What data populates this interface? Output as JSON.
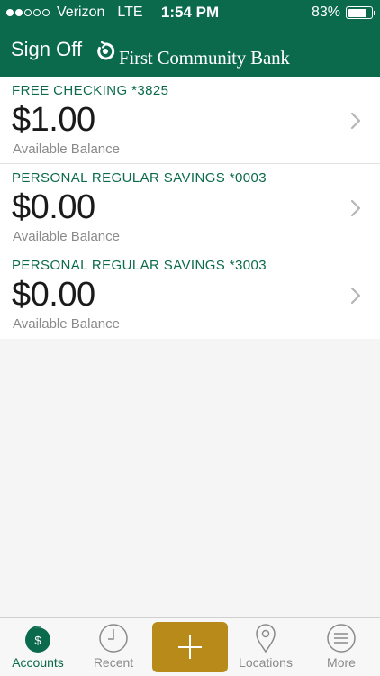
{
  "status_bar": {
    "carrier": "Verizon",
    "network": "LTE",
    "time": "1:54 PM",
    "battery": "83%",
    "battery_level": 0.83,
    "signal_bars_filled": 2,
    "signal_bars_total": 5
  },
  "header": {
    "sign_off_label": "Sign Off",
    "brand_name": "First Community Bank",
    "brand_logo_icon": "bank-logo-icon"
  },
  "accounts": [
    {
      "name": "FREE CHECKING *3825",
      "balance": "$1.00",
      "balance_label": "Available Balance"
    },
    {
      "name": "PERSONAL REGULAR SAVINGS *0003",
      "balance": "$0.00",
      "balance_label": "Available Balance"
    },
    {
      "name": "PERSONAL REGULAR SAVINGS *3003",
      "balance": "$0.00",
      "balance_label": "Available Balance"
    }
  ],
  "tab_bar": {
    "tabs": [
      {
        "label": "Accounts",
        "icon": "dollar-circle-icon",
        "active": true
      },
      {
        "label": "Recent",
        "icon": "clock-icon",
        "active": false
      },
      {
        "label": "",
        "icon": "plus-icon",
        "active": false
      },
      {
        "label": "Locations",
        "icon": "map-pin-icon",
        "active": false
      },
      {
        "label": "More",
        "icon": "menu-icon",
        "active": false
      }
    ]
  },
  "colors": {
    "brand_green": "#0b6a4c",
    "accent_gold": "#b78a1a",
    "background": "#f5f5f5"
  }
}
